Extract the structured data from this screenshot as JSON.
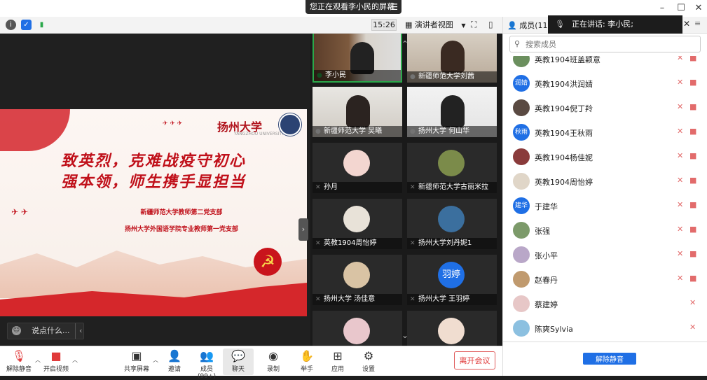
{
  "share_notice": "您正在观看李小民的屏幕",
  "toolbar": {
    "timer": "15:26",
    "view_label": "演讲者视图"
  },
  "slide": {
    "university": "扬州大学",
    "university_en": "YANGZHOU UNIVERSITY",
    "line1": "致英烈，克难战疫守初心",
    "line2": "强本领，师生携手显担当",
    "sub1": "新疆师范大学教师第二党支部",
    "sub2": "扬州大学外国语学院专业教师第一党支部"
  },
  "chat_input_placeholder": "说点什么...",
  "tiles": [
    {
      "name": "李小民"
    },
    {
      "name": "新疆师范大学刘茜"
    },
    {
      "name": "新疆师范大学 吴曦"
    },
    {
      "name": "扬州大学 何山华"
    },
    {
      "name": "孙月"
    },
    {
      "name": "新疆师范大学古丽米拉"
    },
    {
      "name": "英教1904周怡婷"
    },
    {
      "name": "扬州大学刘丹妮1"
    },
    {
      "name": "扬州大学 汤佳意"
    },
    {
      "name": "扬州大学 王羽婷"
    }
  ],
  "tile_avatar_text": "羽婷",
  "panel": {
    "title": "成员(116)",
    "speaking": "正在讲话: 李小民;",
    "search_placeholder": "搜索成员",
    "unmute_all": "解除静音"
  },
  "members": [
    {
      "name": "英教1904班盖颖意",
      "avatar": ""
    },
    {
      "name": "英教1904洪润婧",
      "avatar": "润婧"
    },
    {
      "name": "英教1904倪丁羚",
      "avatar": ""
    },
    {
      "name": "英教1904王秋雨",
      "avatar": "秋雨"
    },
    {
      "name": "英教1904杨佳妮",
      "avatar": ""
    },
    {
      "name": "英教1904周怡婷",
      "avatar": ""
    },
    {
      "name": "于建华",
      "avatar": "建华"
    },
    {
      "name": "张强",
      "avatar": ""
    },
    {
      "name": "张小平",
      "avatar": ""
    },
    {
      "name": "赵春丹",
      "avatar": ""
    },
    {
      "name": "蔡建婷",
      "avatar": ""
    },
    {
      "name": "陈爽Sylvia",
      "avatar": ""
    }
  ],
  "bottom": {
    "unmute": "解除静音",
    "video": "开启视频",
    "share": "共享屏幕",
    "invite": "邀请",
    "members": "成员(99+)",
    "chat": "聊天",
    "record": "录制",
    "raise": "举手",
    "apps": "应用",
    "settings": "设置",
    "leave": "离开会议"
  },
  "colors": {
    "accent": "#1f6fe5",
    "leave": "#e03a3a",
    "slide_red": "#c0101a"
  }
}
